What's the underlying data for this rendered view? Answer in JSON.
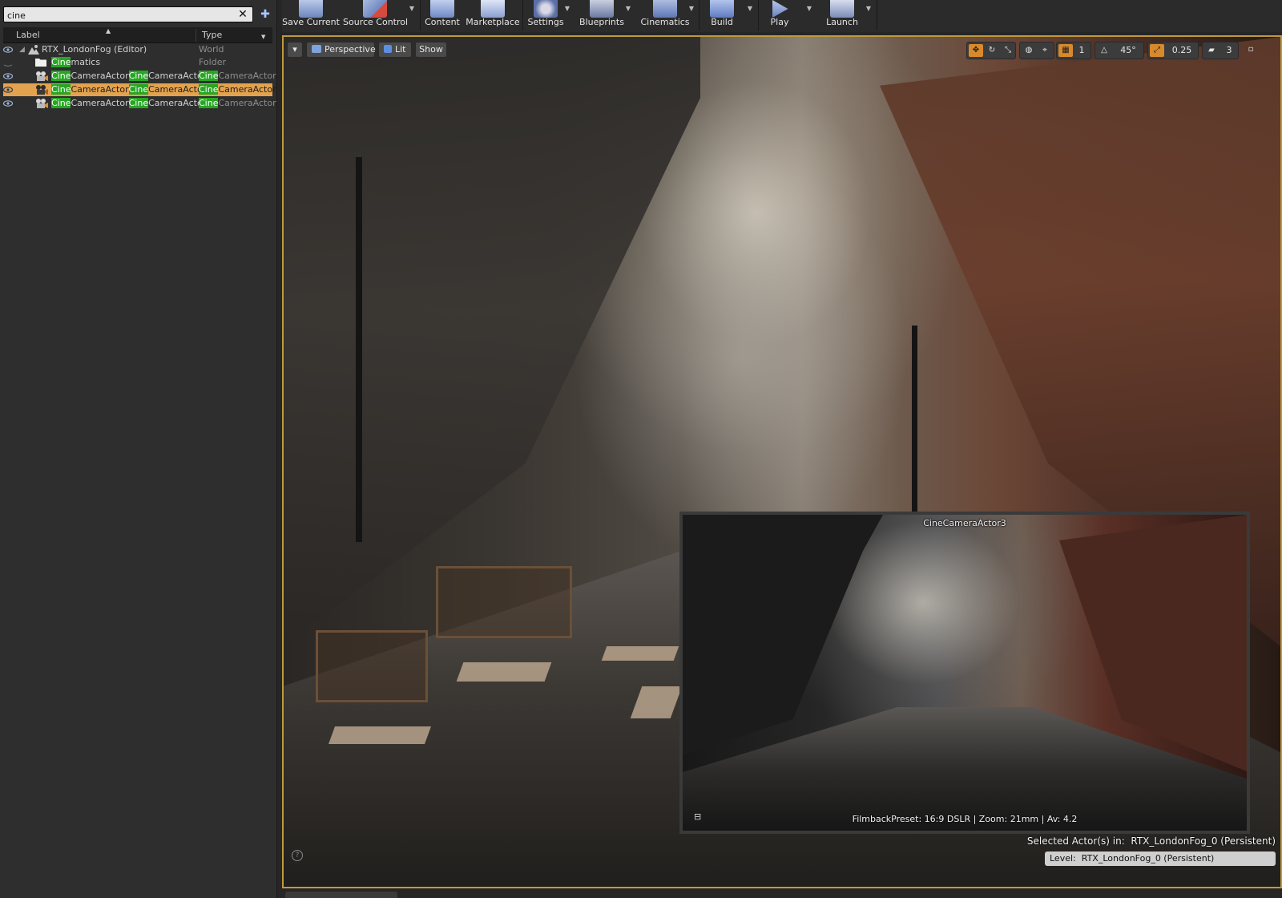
{
  "outliner": {
    "search": {
      "value": "cine",
      "clear_icon": "close-icon",
      "options_icon": "pin-icon"
    },
    "columns": {
      "label": "Label",
      "type": "Type"
    },
    "rows": [
      {
        "label": "RTX_LondonFog (Editor)",
        "type": "World",
        "icon": "world-icon"
      },
      {
        "label_hl": "Cine",
        "label_rest": "matics",
        "type": "Folder",
        "icon": "folder-icon"
      },
      {
        "label_a": "Cine",
        "label_b": "CameraActor",
        "label_c": "Cine",
        "label_d": "CameraActor",
        "type_hl": "Cine",
        "type_rest": "CameraActor",
        "icon": "camera-actor-icon",
        "selected": false
      },
      {
        "label_a": "Cine",
        "label_b": "CameraActor",
        "label_c": "Cine",
        "label_d": "CameraActor",
        "type_hl": "Cine",
        "type_rest": "CameraActor",
        "icon": "camera-actor-icon",
        "selected": true
      },
      {
        "label_a": "Cine",
        "label_b": "CameraActor",
        "label_c": "Cine",
        "label_d": "CameraActor",
        "type_hl": "Cine",
        "type_rest": "CameraActor",
        "icon": "camera-actor-icon",
        "selected": false
      }
    ]
  },
  "toolbar": {
    "items": [
      {
        "label": "Save Current",
        "icon": "save-icon"
      },
      {
        "label": "Source Control",
        "icon": "source-control-icon"
      },
      {
        "label": "Content",
        "icon": "content-icon"
      },
      {
        "label": "Marketplace",
        "icon": "marketplace-icon"
      },
      {
        "label": "Settings",
        "icon": "settings-icon"
      },
      {
        "label": "Blueprints",
        "icon": "blueprints-icon"
      },
      {
        "label": "Cinematics",
        "icon": "cinematics-icon"
      },
      {
        "label": "Build",
        "icon": "build-icon"
      },
      {
        "label": "Play",
        "icon": "play-icon"
      },
      {
        "label": "Launch",
        "icon": "launch-icon"
      }
    ]
  },
  "viewport": {
    "menu_icon": "chevron-down-icon",
    "perspective": "Perspective",
    "lit": "Lit",
    "show": "Show",
    "grid_snap": "1",
    "rotation_snap": "45°",
    "scale_snap": "0.25",
    "camera_speed": "3",
    "selected_actors_label": "Selected Actor(s) in:",
    "selected_actors_value": "RTX_LondonFog_0 (Persistent)",
    "level_label": "Level:",
    "level_value": "RTX_LondonFog_0 (Persistent)",
    "camera_preview": {
      "title": "CineCameraActor3",
      "info": "FilmbackPreset: 16:9 DSLR | Zoom: 21mm | Av: 4.2"
    }
  },
  "colors": {
    "selection": "#e3a24e",
    "highlight": "#27a624",
    "viewport_border": "#bf9a3c",
    "active_toggle": "#d8892b"
  }
}
